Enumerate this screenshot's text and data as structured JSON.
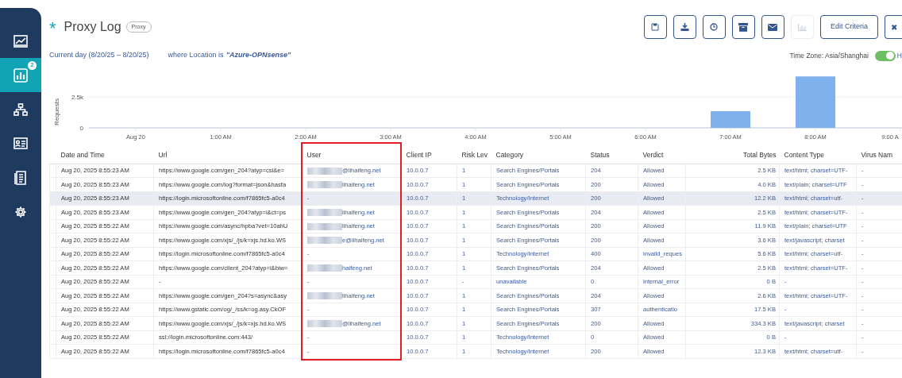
{
  "sidebar": {
    "items": [
      {
        "selected": false
      },
      {
        "selected": true,
        "badge": "2"
      },
      {
        "selected": false
      },
      {
        "selected": false
      },
      {
        "selected": false
      },
      {
        "selected": false
      }
    ]
  },
  "header": {
    "icon": "*",
    "title": "Proxy Log",
    "tag": "Proxy"
  },
  "toolbar": {
    "buttons": [
      {
        "disabled": false
      },
      {
        "disabled": false
      },
      {
        "disabled": false
      },
      {
        "disabled": false
      },
      {
        "disabled": false
      },
      {
        "disabled": true
      }
    ],
    "edit_label": "Edit Criteria",
    "close_label": "✖"
  },
  "filter": {
    "period": "Current day (8/20/25 – 8/20/25)",
    "condition": "where Location is",
    "value": "\"Azure-OPNsense\""
  },
  "timezone": {
    "label": "Time Zone: Asia/Shanghai",
    "toggle_on": true,
    "toggle_label": "H"
  },
  "chart": {
    "chart_data": {
      "type": "bar",
      "ylabel": "Requests",
      "categories": [
        "Aug 20",
        "1:00 AM",
        "2:00 AM",
        "3:00 AM",
        "4:00 AM",
        "5:00 AM",
        "6:00 AM",
        "7:00 AM",
        "8:00 AM",
        "9:00 A"
      ],
      "series": [
        {
          "color": "#7fb2ec",
          "values": [
            0,
            0,
            0,
            0,
            0,
            0,
            0,
            1350,
            4170,
            0
          ]
        }
      ],
      "ylim": [
        0,
        4250
      ],
      "yticks": [
        0,
        {
          "value": 2500,
          "label": "2.5k"
        }
      ]
    }
  },
  "table": {
    "columns": [
      {
        "label": "Date and Time",
        "highlighted": false
      },
      {
        "label": "Url",
        "highlighted": false
      },
      {
        "label": "User",
        "highlighted": true
      },
      {
        "label": "Client IP",
        "highlighted": false
      },
      {
        "label": "Risk Lev",
        "highlighted": false
      },
      {
        "label": "Category",
        "highlighted": false
      },
      {
        "label": "Status",
        "highlighted": false
      },
      {
        "label": "Verdict",
        "highlighted": false
      },
      {
        "label": "Total Bytes",
        "highlighted": false
      },
      {
        "label": "Content Type",
        "highlighted": false
      },
      {
        "label": "Virus Nam",
        "highlighted": false
      }
    ],
    "rows": [
      {
        "hovered": false,
        "date": "Aug 20, 2025 8:55:23 AM",
        "url": "https://www.google.com/gen_204?atyp=csi&e=",
        "user_redacted": true,
        "user": "@lihaifeng.net",
        "client_ip": "10.0.0.7",
        "risk": "1",
        "category": "Search Engines/Portals",
        "status": "204",
        "verdict": "Allowed",
        "total_bytes": "2.5 KB",
        "content_type": "text/html; charset=UTF-",
        "virus": "-"
      },
      {
        "hovered": false,
        "date": "Aug 20, 2025 8:55:23 AM",
        "url": "https://www.google.com/log?format=json&hasfa",
        "user_redacted": true,
        "user": "lihaifeng.net",
        "client_ip": "10.0.0.7",
        "risk": "1",
        "category": "Search Engines/Portals",
        "status": "200",
        "verdict": "Allowed",
        "total_bytes": "4.0 KB",
        "content_type": "text/plain; charset=UTF",
        "virus": "-"
      },
      {
        "hovered": true,
        "date": "Aug 20, 2025 8:55:23 AM",
        "url": "https://login.microsoftonline.com/f7865fc5-a0c4",
        "user_redacted": false,
        "user": "-",
        "client_ip": "10.0.0.7",
        "risk": "1",
        "category": "Technology/Internet",
        "status": "200",
        "verdict": "Allowed",
        "total_bytes": "12.2 KB",
        "content_type": "text/html; charset=utf-",
        "virus": "-"
      },
      {
        "hovered": false,
        "date": "Aug 20, 2025 8:55:23 AM",
        "url": "https://www.google.com/gen_204?atyp=i&ct=ps",
        "user_redacted": true,
        "user": "lihaifeng.net",
        "client_ip": "10.0.0.7",
        "risk": "1",
        "category": "Search Engines/Portals",
        "status": "204",
        "verdict": "Allowed",
        "total_bytes": "2.5 KB",
        "content_type": "text/html; charset=UTF-",
        "virus": "-"
      },
      {
        "hovered": false,
        "date": "Aug 20, 2025 8:55:22 AM",
        "url": "https://www.google.com/async/hpba?vet=10ahU",
        "user_redacted": true,
        "user": "lihaifeng.net",
        "client_ip": "10.0.0.7",
        "risk": "1",
        "category": "Search Engines/Portals",
        "status": "200",
        "verdict": "Allowed",
        "total_bytes": "11.9 KB",
        "content_type": "text/plain; charset=UTF",
        "virus": "-"
      },
      {
        "hovered": false,
        "date": "Aug 20, 2025 8:55:22 AM",
        "url": "https://www.google.com/xjs/_/js/k=xjs.hd.ko.WS",
        "user_redacted": true,
        "user": "e@lihaifeng.net",
        "client_ip": "10.0.0.7",
        "risk": "1",
        "category": "Search Engines/Portals",
        "status": "200",
        "verdict": "Allowed",
        "total_bytes": "3.6 KB",
        "content_type": "text/javascript; charset",
        "virus": "-"
      },
      {
        "hovered": false,
        "date": "Aug 20, 2025 8:55:22 AM",
        "url": "https://login.microsoftonline.com/f7865fc5-a0c4",
        "user_redacted": false,
        "user": "-",
        "client_ip": "10.0.0.7",
        "risk": "1",
        "category": "Technology/Internet",
        "status": "400",
        "verdict": "invalid_reques",
        "total_bytes": "5.6 KB",
        "content_type": "text/html; charset=utf-",
        "virus": "-"
      },
      {
        "hovered": false,
        "date": "Aug 20, 2025 8:55:22 AM",
        "url": "https://www.google.com/client_204?atyp=i&biw=",
        "user_redacted": true,
        "user": "haifeng.net",
        "client_ip": "10.0.0.7",
        "risk": "1",
        "category": "Search Engines/Portals",
        "status": "204",
        "verdict": "Allowed",
        "total_bytes": "2.5 KB",
        "content_type": "text/html; charset=UTF-",
        "virus": "-"
      },
      {
        "hovered": false,
        "date": "Aug 20, 2025 8:55:22 AM",
        "url": "-",
        "user_redacted": false,
        "user": "-",
        "client_ip": "10.0.0.7",
        "risk": "-",
        "category": "unavailable",
        "status": "0",
        "verdict": "internal_error",
        "total_bytes": "0 B",
        "content_type": "-",
        "virus": "-"
      },
      {
        "hovered": false,
        "date": "Aug 20, 2025 8:55:22 AM",
        "url": "https://www.google.com/gen_204?s=async&asy",
        "user_redacted": true,
        "user": "lihaifeng.net",
        "client_ip": "10.0.0.7",
        "risk": "1",
        "category": "Search Engines/Portals",
        "status": "204",
        "verdict": "Allowed",
        "total_bytes": "2.6 KB",
        "content_type": "text/html; charset=UTF-",
        "virus": "-"
      },
      {
        "hovered": false,
        "date": "Aug 20, 2025 8:55:22 AM",
        "url": "https://www.gstatic.com/og/_/ss/k=og.asy.CkOF",
        "user_redacted": false,
        "user": "-",
        "client_ip": "10.0.0.7",
        "risk": "1",
        "category": "Search Engines/Portals",
        "status": "307",
        "verdict": "authenticatio",
        "total_bytes": "17.5 KB",
        "content_type": "-",
        "virus": "-"
      },
      {
        "hovered": false,
        "date": "Aug 20, 2025 8:55:22 AM",
        "url": "https://www.google.com/xjs/_/js/k=xjs.hd.ko.WS",
        "user_redacted": true,
        "user": "@lihaifeng.net",
        "client_ip": "10.0.0.7",
        "risk": "1",
        "category": "Search Engines/Portals",
        "status": "200",
        "verdict": "Allowed",
        "total_bytes": "334.3 KB",
        "content_type": "text/javascript; charset",
        "virus": "-"
      },
      {
        "hovered": false,
        "date": "Aug 20, 2025 8:55:22 AM",
        "url": "ssl://login.microsoftonline.com:443/",
        "user_redacted": false,
        "user": "-",
        "client_ip": "10.0.0.7",
        "risk": "1",
        "category": "Technology/Internet",
        "status": "0",
        "verdict": "Allowed",
        "total_bytes": "0 B",
        "content_type": "-",
        "virus": "-"
      },
      {
        "hovered": false,
        "date": "Aug 20, 2025 8:55:22 AM",
        "url": "https://login.microsoftonline.com/f7865fc5-a0c4",
        "user_redacted": false,
        "user": "-",
        "client_ip": "10.0.0.7",
        "risk": "1",
        "category": "Technology/Internet",
        "status": "200",
        "verdict": "Allowed",
        "total_bytes": "12.3 KB",
        "content_type": "text/html; charset=utf-",
        "virus": "-"
      }
    ]
  }
}
